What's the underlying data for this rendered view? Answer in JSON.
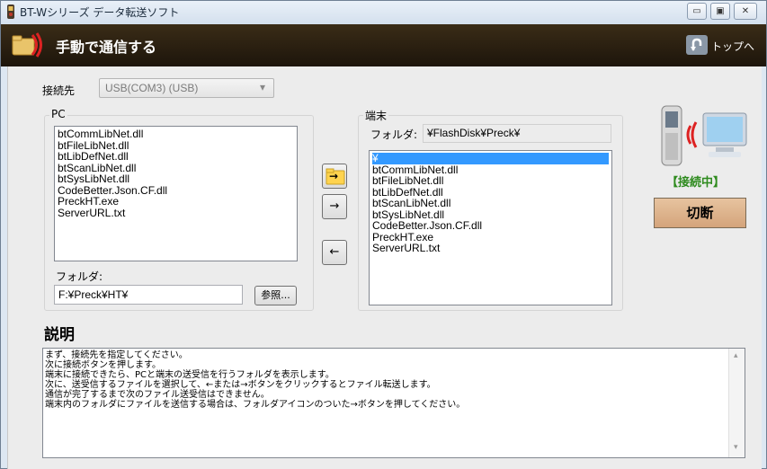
{
  "window": {
    "title": "BT-Wシリーズ データ転送ソフト",
    "minimize_glyph": "▭",
    "maximize_glyph": "▣",
    "close_glyph": "✕"
  },
  "header": {
    "title": "手動で通信する",
    "top_label": "トップへ",
    "top_icon": "return-arrow-icon"
  },
  "connection": {
    "label": "接続先",
    "value": "USB(COM3) (USB)",
    "dropdown_glyph": "▾"
  },
  "pc": {
    "group_label": "PC",
    "files": [
      "btCommLibNet.dll",
      "btFileLibNet.dll",
      "btLibDefNet.dll",
      "btScanLibNet.dll",
      "btSysLibNet.dll",
      "CodeBetter.Json.CF.dll",
      "PreckHT.exe",
      "ServerURL.txt"
    ],
    "folder_label": "フォルダ:",
    "folder_value": "F:¥Preck¥HT¥",
    "browse_label": "参照..."
  },
  "transfer": {
    "to_folder_glyph": "→",
    "to_terminal_glyph": "→",
    "to_pc_glyph": "←"
  },
  "terminal": {
    "group_label": "端末",
    "folder_label": "フォルダ:",
    "folder_value": "¥FlashDisk¥Preck¥",
    "files": [
      "¥",
      "btCommLibNet.dll",
      "btFileLibNet.dll",
      "btLibDefNet.dll",
      "btScanLibNet.dll",
      "btSysLibNet.dll",
      "CodeBetter.Json.CF.dll",
      "PreckHT.exe",
      "ServerURL.txt"
    ]
  },
  "status": {
    "text": "【接続中】",
    "color": "#2e8b1e",
    "disconnect_label": "切断"
  },
  "description": {
    "heading": "説明",
    "lines": [
      "まず、接続先を指定してください。",
      "次に接続ボタンを押します。",
      "端末に接続できたら、PCと端末の送受信を行うフォルダを表示します。",
      "次に、送受信するファイルを選択して、←または→ボタンをクリックするとファイル転送します。",
      "通信が完了するまで次のファイル送受信はできません。",
      "端末内のフォルダにファイルを送信する場合は、フォルダアイコンのついた→ボタンを押してください。"
    ],
    "scroll_up_glyph": "▴",
    "scroll_down_glyph": "▾"
  }
}
